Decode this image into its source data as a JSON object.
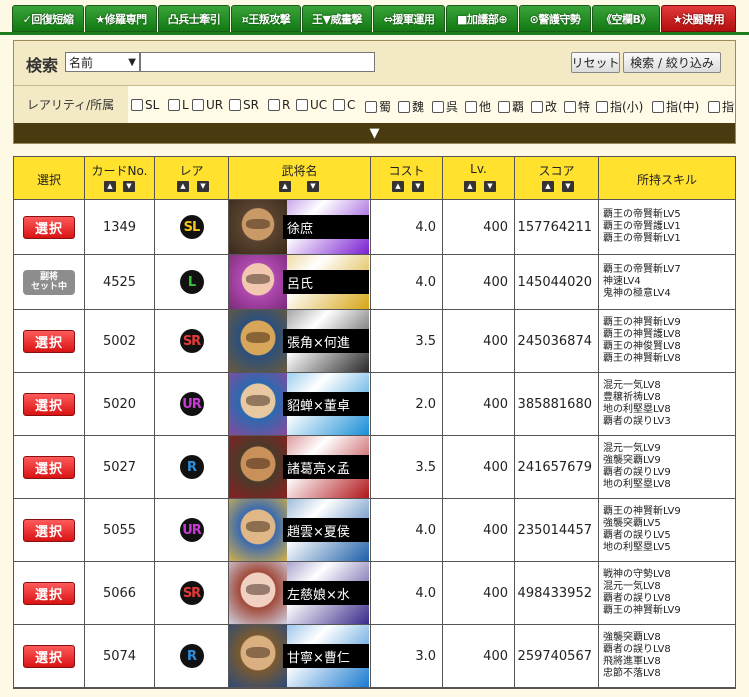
{
  "tabs": [
    {
      "label": "✓回復短縮",
      "color": "green"
    },
    {
      "label": "★修羅専門",
      "color": "green"
    },
    {
      "label": "凸兵士牽引",
      "color": "green"
    },
    {
      "label": "¤王叛攻撃",
      "color": "green"
    },
    {
      "label": "王▼威畫撃",
      "color": "green"
    },
    {
      "label": "⇔援軍運用",
      "color": "green"
    },
    {
      "label": "■加護部⊕",
      "color": "green"
    },
    {
      "label": "⊙警護守勢",
      "color": "green"
    },
    {
      "label": "《空欄B》",
      "color": "green"
    },
    {
      "label": "★決闘専用",
      "color": "red"
    }
  ],
  "search": {
    "title": "検索",
    "field_selected": "名前",
    "query": "",
    "reset_label": "リセット",
    "submit_label": "検索 / 絞り込み"
  },
  "filters": {
    "label": "レアリティ/所属",
    "options": [
      "SL",
      "L",
      "UR",
      "SR",
      "R",
      "UC",
      "C",
      "蜀",
      "魏",
      "呉",
      "他",
      "覇",
      "改",
      "特",
      "指(小)",
      "指(中)",
      "指"
    ],
    "toggle_icon": "▼"
  },
  "table": {
    "headers": {
      "select": "選択",
      "card_no": "カードNo.",
      "rarity": "レア",
      "name": "武将名",
      "cost": "コスト",
      "lv": "Lv.",
      "score": "スコア",
      "skills": "所持スキル"
    },
    "rows": [
      {
        "action": "選択",
        "card_no": "1349",
        "rarity": "SL",
        "rarity_color": "#f2c41b",
        "name": "徐庶",
        "band_color": "#7a1fd0",
        "cost": "4.0",
        "lv": "400",
        "score": "157764211",
        "skills": [
          "覇王の帝賢斬LV5",
          "覇王の帝賢護LV1",
          "覇王の帝賢斬LV1"
        ],
        "face_colors": [
          "#5a4330",
          "#c99a66",
          "#3a2a1a"
        ]
      },
      {
        "action_badge": [
          "副将",
          "セット中"
        ],
        "card_no": "4525",
        "rarity": "L",
        "rarity_color": "#39c23b",
        "name": "呂氏",
        "band_color": "#d6a514",
        "cost": "4.0",
        "lv": "400",
        "score": "145044020",
        "skills": [
          "覇王の帝賢斬LV7",
          "神速LV4",
          "鬼神の極意LV4"
        ],
        "face_colors": [
          "#b04ab0",
          "#f2c9b0",
          "#7a2a7a"
        ]
      },
      {
        "action": "選択",
        "card_no": "5002",
        "rarity": "SR",
        "rarity_color": "#e43a3a",
        "name": "張角×何進",
        "band_color": "#2a2a2a",
        "cost": "3.5",
        "lv": "400",
        "score": "245036874",
        "skills": [
          "覇王の神賢斬LV9",
          "覇王の神賢護LV8",
          "覇王の神俊賢LV8",
          "覇王の神賢斬LV8"
        ],
        "face_colors": [
          "#2b4f7d",
          "#d7a65a",
          "#6a5a3a"
        ]
      },
      {
        "action": "選択",
        "card_no": "5020",
        "rarity": "UR",
        "rarity_color": "#c93ad6",
        "name": "貂蝉×董卓",
        "band_color": "#1a8ed6",
        "cost": "2.0",
        "lv": "400",
        "score": "385881680",
        "skills": [
          "混元一気LV8",
          "豊穣祈祷LV8",
          "地の利堅塁LV8",
          "覇者の誤りLV3"
        ],
        "face_colors": [
          "#2a6ab0",
          "#e8c8a0",
          "#8a4a9a"
        ]
      },
      {
        "action": "選択",
        "card_no": "5027",
        "rarity": "R",
        "rarity_color": "#2a8fe0",
        "name": "諸葛亮×孟",
        "band_color": "#b0151a",
        "cost": "3.5",
        "lv": "400",
        "score": "241657679",
        "skills": [
          "混元一気LV9",
          "強襲突覇LV9",
          "覇者の誤りLV9",
          "地の利堅塁LV8"
        ],
        "face_colors": [
          "#4a3a2a",
          "#c9905a",
          "#8a2020"
        ]
      },
      {
        "action": "選択",
        "card_no": "5055",
        "rarity": "UR",
        "rarity_color": "#c93ad6",
        "name": "趙雲×夏侯",
        "band_color": "#1e5fa8",
        "cost": "4.0",
        "lv": "400",
        "score": "235014457",
        "skills": [
          "覇王の神賢斬LV9",
          "強襲突覇LV5",
          "覇者の誤りLV5",
          "地の利堅塁LV5"
        ],
        "face_colors": [
          "#3a6ab0",
          "#e0b888",
          "#d4b04a"
        ]
      },
      {
        "action": "選択",
        "card_no": "5066",
        "rarity": "SR",
        "rarity_color": "#e43a3a",
        "name": "左慈娘×水",
        "band_color": "#3a2a8a",
        "cost": "4.0",
        "lv": "400",
        "score": "498433952",
        "skills": [
          "戦神の守勢LV8",
          "混元一気LV8",
          "覇者の誤りLV8",
          "覇王の神賢斬LV9"
        ],
        "face_colors": [
          "#a04a3a",
          "#f0d0c0",
          "#d0d0e0"
        ]
      },
      {
        "action": "選択",
        "card_no": "5074",
        "rarity": "R",
        "rarity_color": "#2a8fe0",
        "name": "甘寧×曹仁",
        "band_color": "#1a7ad0",
        "cost": "3.0",
        "lv": "400",
        "score": "259740567",
        "skills": [
          "強襲突覇LV8",
          "覇者の誤りLV8",
          "飛將進軍LV8",
          "忠節不落LV8"
        ],
        "face_colors": [
          "#7a5a30",
          "#dab080",
          "#2a4a7a"
        ]
      }
    ]
  }
}
